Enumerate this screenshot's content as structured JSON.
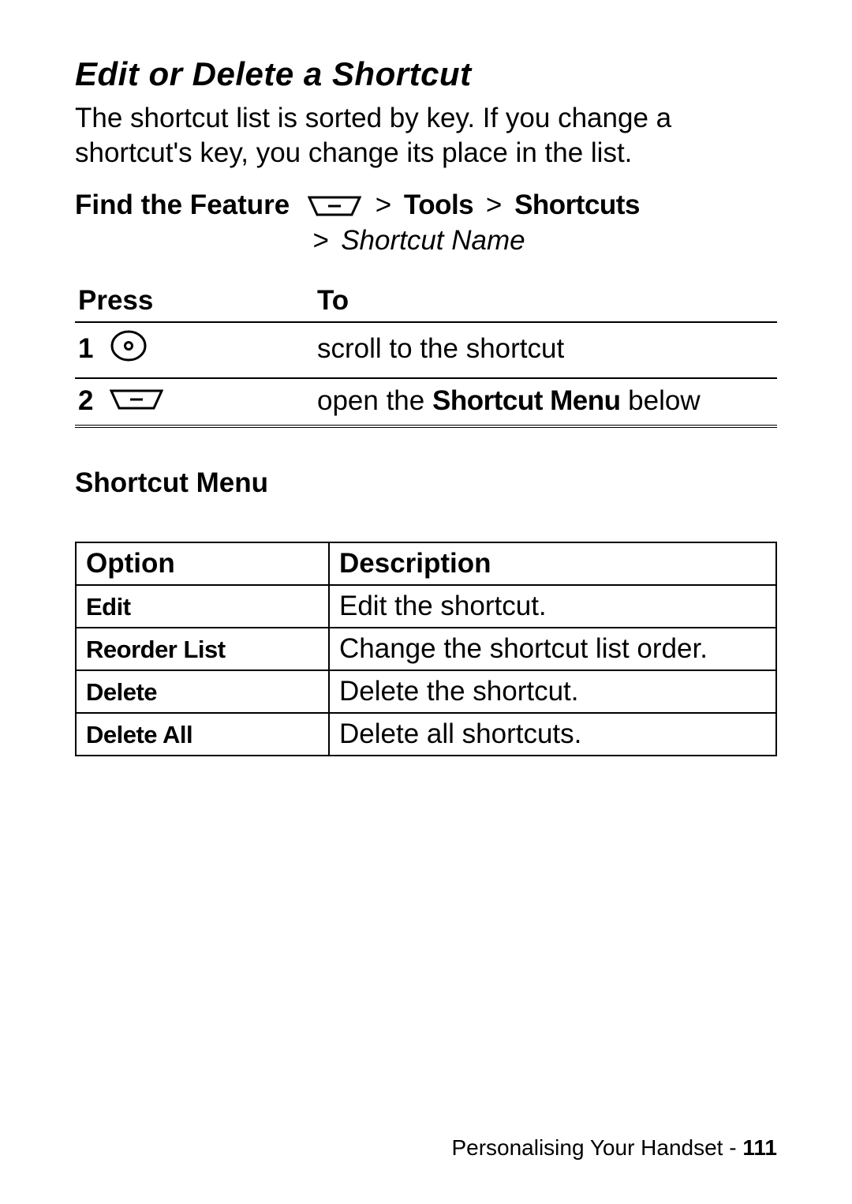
{
  "title": "Edit or Delete a Shortcut",
  "intro": "The shortcut list is sorted by key. If you change a shortcut's key, you change its place in the list.",
  "find_feature": {
    "label": "Find the Feature",
    "gt": ">",
    "tools": "Tools",
    "shortcuts": "Shortcuts",
    "shortcut_name": "Shortcut Name"
  },
  "steps": {
    "press_header": "Press",
    "to_header": "To",
    "rows": [
      {
        "num": "1",
        "icon": "nav",
        "to_pre": "scroll to the shortcut",
        "to_bold": "",
        "to_post": ""
      },
      {
        "num": "2",
        "icon": "menu",
        "to_pre": "open the ",
        "to_bold": "Shortcut Menu",
        "to_post": " below"
      }
    ]
  },
  "shortcut_menu_heading": "Shortcut Menu",
  "options": {
    "headers": {
      "option": "Option",
      "description": "Description"
    },
    "rows": [
      {
        "option": "Edit",
        "description": "Edit the shortcut."
      },
      {
        "option": "Reorder List",
        "description": "Change the shortcut list order."
      },
      {
        "option": "Delete",
        "description": "Delete the shortcut."
      },
      {
        "option": "Delete All",
        "description": "Delete all shortcuts."
      }
    ]
  },
  "footer": {
    "section": "Personalising Your Handset - ",
    "page": "111"
  }
}
